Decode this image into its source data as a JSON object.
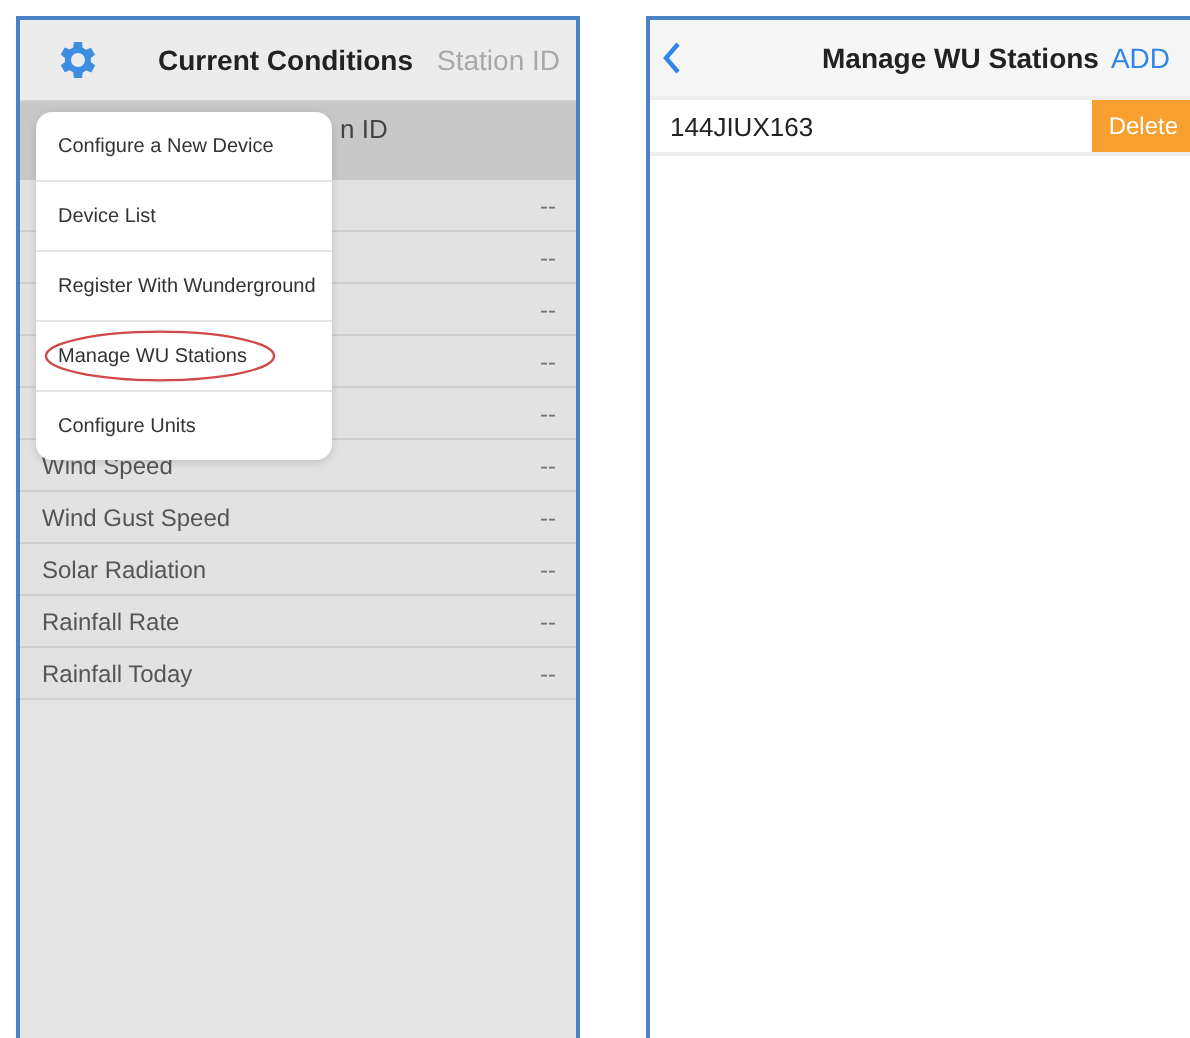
{
  "left_screen": {
    "title": "Current Conditions",
    "station_id_link": "Station ID",
    "section_header": "n ID",
    "rows": [
      {
        "label": "",
        "value": "--"
      },
      {
        "label": "",
        "value": "--"
      },
      {
        "label": "",
        "value": "--"
      },
      {
        "label": "",
        "value": "--"
      },
      {
        "label": "",
        "value": "--"
      },
      {
        "label": "Wind Speed",
        "value": "--"
      },
      {
        "label": "Wind Gust Speed",
        "value": "--"
      },
      {
        "label": "Solar Radiation",
        "value": "--"
      },
      {
        "label": "Rainfall Rate",
        "value": "--"
      },
      {
        "label": "Rainfall Today",
        "value": "--"
      }
    ],
    "menu": [
      {
        "label": "Configure a New Device",
        "highlighted": false
      },
      {
        "label": "Device List",
        "highlighted": false
      },
      {
        "label": "Register With Wunderground",
        "highlighted": false
      },
      {
        "label": "Manage WU Stations",
        "highlighted": true
      },
      {
        "label": "Configure Units",
        "highlighted": false
      }
    ]
  },
  "right_screen": {
    "title": "Manage WU Stations",
    "add_button": "ADD",
    "stations": [
      {
        "id": "144JIUX163",
        "delete_button": "Delete"
      }
    ]
  }
}
